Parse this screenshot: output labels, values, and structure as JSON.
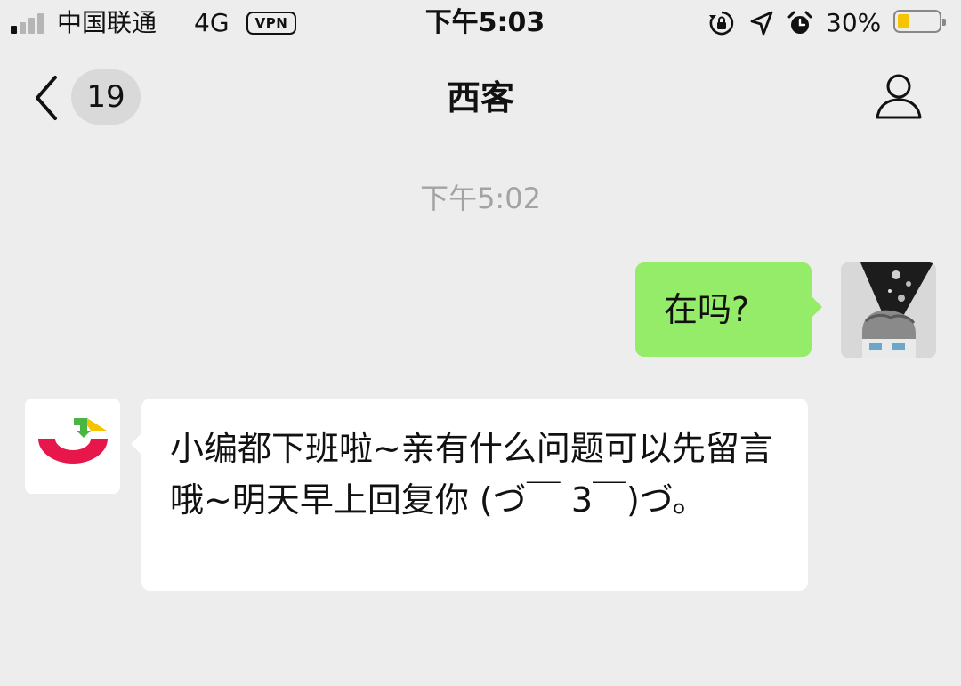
{
  "status_bar": {
    "carrier": "中国联通",
    "network": "4G",
    "vpn": "VPN",
    "time": "下午5:03",
    "battery_percent": "30%",
    "battery_level": 0.3,
    "signal_bars_total": 4,
    "signal_bars_filled": 1,
    "icons": [
      "rotation-lock-icon",
      "location-arrow-icon",
      "alarm-icon"
    ]
  },
  "nav": {
    "back_icon": "chevron-left-icon",
    "unread_count": "19",
    "title": "西客",
    "profile_icon": "person-outline-icon"
  },
  "chat": {
    "timestamp": "下午5:02",
    "messages": [
      {
        "direction": "sent",
        "text": "在吗?",
        "bubble_color": "#95ec69",
        "avatar": "user-avatar-illustration"
      },
      {
        "direction": "received",
        "text": "小编都下班啦~亲有什么问题可以先留言哦~明天早上回复你 (づ￣ 3￣)づ。",
        "bubble_color": "#ffffff",
        "avatar": "shop-logo"
      }
    ]
  },
  "colors": {
    "background": "#ededed",
    "sent_bubble": "#95ec69",
    "received_bubble": "#ffffff",
    "timestamp_text": "#a3a3a3",
    "logo_red": "#e8174b",
    "logo_green": "#4bb543",
    "logo_yellow": "#f5c400",
    "battery_fill": "#f5c400"
  }
}
